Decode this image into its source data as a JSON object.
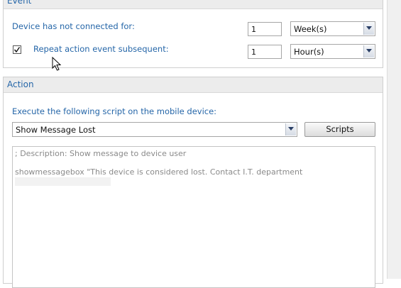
{
  "event_panel": {
    "title": "Event",
    "not_connected_label": "Device has not connected for:",
    "not_connected_value": "1",
    "not_connected_unit": "Week(s)",
    "repeat_checked": true,
    "repeat_label": "Repeat action event subsequent:",
    "repeat_value": "1",
    "repeat_unit": "Hour(s)"
  },
  "action_panel": {
    "title": "Action",
    "execute_label": "Execute the following script on the mobile device:",
    "script_selected": "Show Message Lost",
    "scripts_button": "Scripts",
    "script_lines": [
      "; Description: Show message to device user",
      "showmessagebox \"This device is considered lost. Contact I.T. department"
    ]
  },
  "colors": {
    "label_blue": "#2566a8",
    "header_bg": "#ececec"
  },
  "icons": {
    "dropdown": "chevron-down-icon",
    "checkbox": "checkmark-icon",
    "cursor": "mouse-pointer-icon"
  }
}
